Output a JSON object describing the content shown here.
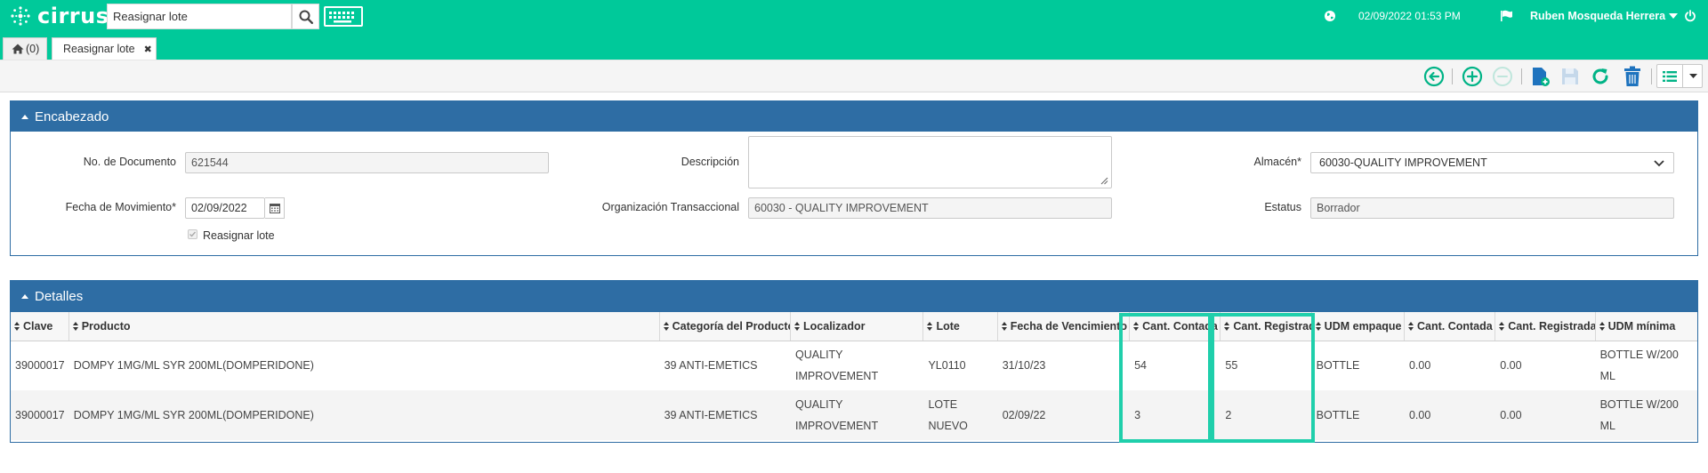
{
  "app": {
    "brand": "cirrus"
  },
  "header": {
    "search_value": "Reasignar lote",
    "datetime": "02/09/2022 01:53 PM",
    "user": "Ruben Mosqueda Herrera"
  },
  "tabs": [
    {
      "label": "(0)"
    },
    {
      "label": "Reasignar lote",
      "close": "✖"
    }
  ],
  "encabezado": {
    "title": "Encabezado",
    "doc_label": "No. de Documento",
    "doc_value": "621544",
    "fecha_label": "Fecha de Movimiento*",
    "fecha_value": "02/09/2022",
    "reasignar_label": "Reasignar lote",
    "desc_label": "Descripción",
    "desc_value": "",
    "org_label": "Organización Transaccional",
    "org_value": "60030 - QUALITY IMPROVEMENT",
    "almacen_label": "Almacén*",
    "almacen_value": "60030-QUALITY IMPROVEMENT",
    "estatus_label": "Estatus",
    "estatus_value": "Borrador"
  },
  "detalles": {
    "title": "Detalles",
    "columns": [
      "Clave",
      "Producto",
      "Categoría del Producto",
      "Localizador",
      "Lote",
      "Fecha de Vencimiento",
      "Cant. Contada",
      "Cant. Registrada",
      "UDM empaque",
      "Cant. Contada",
      "Cant. Registrada",
      "UDM mínima"
    ],
    "rows": [
      [
        "39000017",
        "DOMPY 1MG/ML SYR 200ML(DOMPERIDONE)",
        "39 ANTI-EMETICS",
        "QUALITY IMPROVEMENT",
        "YL0110",
        "31/10/23",
        "54",
        "55",
        "BOTTLE",
        "0.00",
        "0.00",
        "BOTTLE W/200 ML"
      ],
      [
        "39000017",
        "DOMPY 1MG/ML SYR 200ML(DOMPERIDONE)",
        "39 ANTI-EMETICS",
        "QUALITY IMPROVEMENT",
        "LOTE NUEVO",
        "02/09/22",
        "3",
        "2",
        "BOTTLE",
        "0.00",
        "0.00",
        "BOTTLE W/200 ML"
      ]
    ]
  },
  "colors": {
    "brand": "#00c99a",
    "panel": "#2e6da4",
    "highlight": "#1fcfab"
  }
}
